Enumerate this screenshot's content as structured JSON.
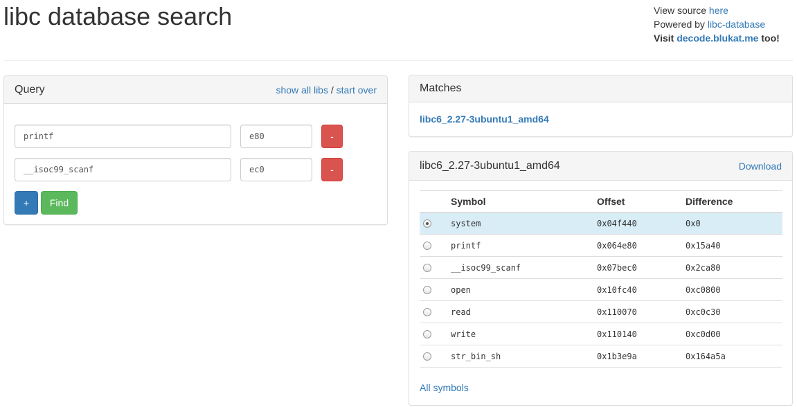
{
  "header": {
    "title": "libc database search",
    "view_source_prefix": "View source ",
    "view_source_link": "here",
    "powered_prefix": "Powered by ",
    "powered_link": "libc-database",
    "visit_prefix": "Visit ",
    "visit_link": "decode.blukat.me",
    "visit_suffix": " too!"
  },
  "query": {
    "heading": "Query",
    "show_all_libs": "show all libs",
    "separator": " / ",
    "start_over": "start over",
    "rows": [
      {
        "symbol": "printf",
        "offset": "e80",
        "remove_label": "-"
      },
      {
        "symbol": "__isoc99_scanf",
        "offset": "ec0",
        "remove_label": "-"
      }
    ],
    "add_label": "+",
    "find_label": "Find"
  },
  "matches": {
    "heading": "Matches",
    "items": [
      "libc6_2.27-3ubuntu1_amd64"
    ]
  },
  "lib": {
    "heading": "libc6_2.27-3ubuntu1_amd64",
    "download_label": "Download",
    "columns": [
      "Symbol",
      "Offset",
      "Difference"
    ],
    "rows": [
      {
        "symbol": "system",
        "offset": "0x04f440",
        "difference": "0x0",
        "selected": true
      },
      {
        "symbol": "printf",
        "offset": "0x064e80",
        "difference": "0x15a40",
        "selected": false
      },
      {
        "symbol": "__isoc99_scanf",
        "offset": "0x07bec0",
        "difference": "0x2ca80",
        "selected": false
      },
      {
        "symbol": "open",
        "offset": "0x10fc40",
        "difference": "0xc0800",
        "selected": false
      },
      {
        "symbol": "read",
        "offset": "0x110070",
        "difference": "0xc0c30",
        "selected": false
      },
      {
        "symbol": "write",
        "offset": "0x110140",
        "difference": "0xc0d00",
        "selected": false
      },
      {
        "symbol": "str_bin_sh",
        "offset": "0x1b3e9a",
        "difference": "0x164a5a",
        "selected": false
      }
    ],
    "all_symbols_label": "All symbols"
  },
  "colors": {
    "link": "#337ab7",
    "danger": "#d9534f",
    "primary": "#337ab7",
    "success": "#5cb85c",
    "selected_row": "#d9edf7"
  }
}
